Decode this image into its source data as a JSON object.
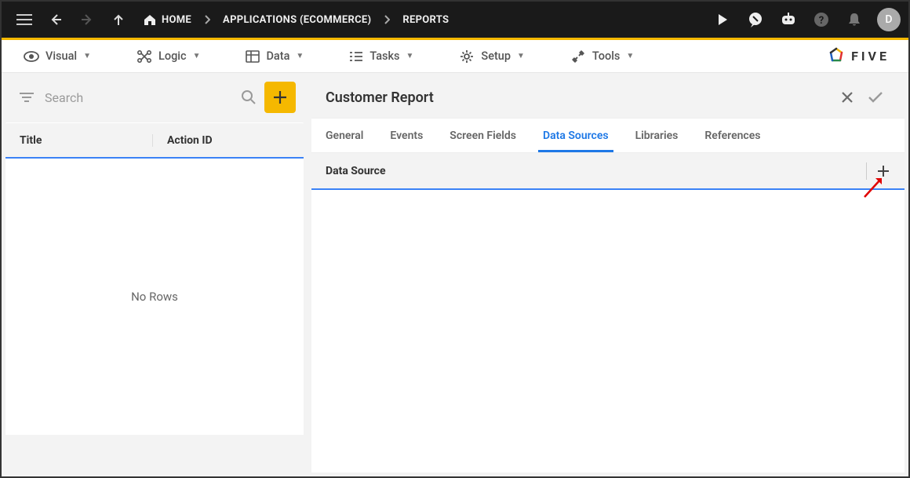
{
  "topbar": {
    "breadcrumbs": [
      "HOME",
      "APPLICATIONS (ECOMMERCE)",
      "REPORTS"
    ],
    "avatar_letter": "D"
  },
  "menubar": {
    "items": [
      "Visual",
      "Logic",
      "Data",
      "Tasks",
      "Setup",
      "Tools"
    ],
    "logo_text": "FIVE"
  },
  "left_panel": {
    "search_placeholder": "Search",
    "columns": [
      "Title",
      "Action ID"
    ],
    "empty_text": "No Rows"
  },
  "right_panel": {
    "title": "Customer Report",
    "tabs": [
      "General",
      "Events",
      "Screen Fields",
      "Data Sources",
      "Libraries",
      "References"
    ],
    "active_tab_index": 3,
    "subhead": "Data Source"
  }
}
